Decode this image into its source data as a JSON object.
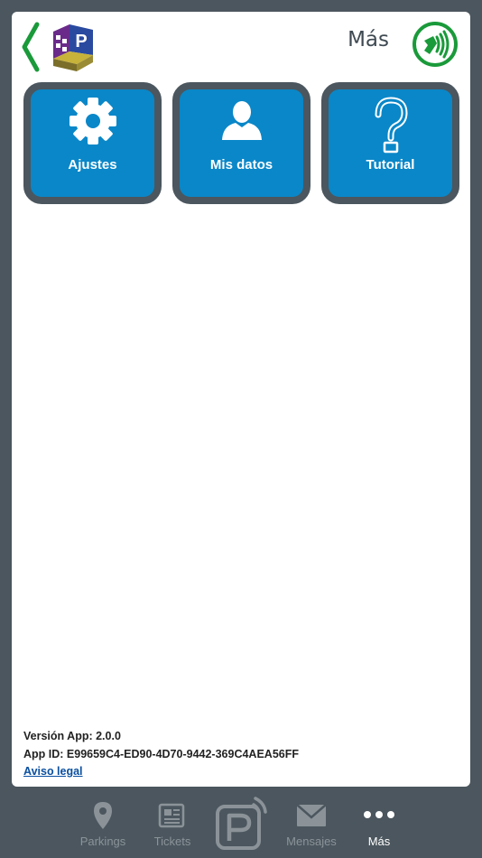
{
  "header": {
    "title": "Más",
    "back_icon": "chevron-left-icon",
    "nfc_icon": "nfc-contactless-icon"
  },
  "tiles": [
    {
      "label": "Ajustes",
      "icon": "gear-icon"
    },
    {
      "label": "Mis datos",
      "icon": "user-icon"
    },
    {
      "label": "Tutorial",
      "icon": "question-mark-icon"
    }
  ],
  "footer": {
    "version_label": "Versión App: 2.0.0",
    "app_id_label": "App ID: E99659C4-ED90-4D70-9442-369C4AEA56FF",
    "legal_link": "Aviso legal"
  },
  "tabbar": {
    "items": [
      {
        "label": "Parkings",
        "icon": "location-pin-icon",
        "active": false
      },
      {
        "label": "Tickets",
        "icon": "ticket-icon",
        "active": false
      },
      {
        "label": "",
        "icon": "parking-nfc-icon",
        "active": false
      },
      {
        "label": "Mensajes",
        "icon": "envelope-icon",
        "active": false
      },
      {
        "label": "Más",
        "icon": "more-dots-icon",
        "active": true
      }
    ]
  },
  "colors": {
    "background": "#4b565e",
    "tile_blue": "#0a87c8",
    "accent_green": "#1a9a3a",
    "logo_purple": "#6a2a8a",
    "link_blue": "#0a4fa0"
  }
}
